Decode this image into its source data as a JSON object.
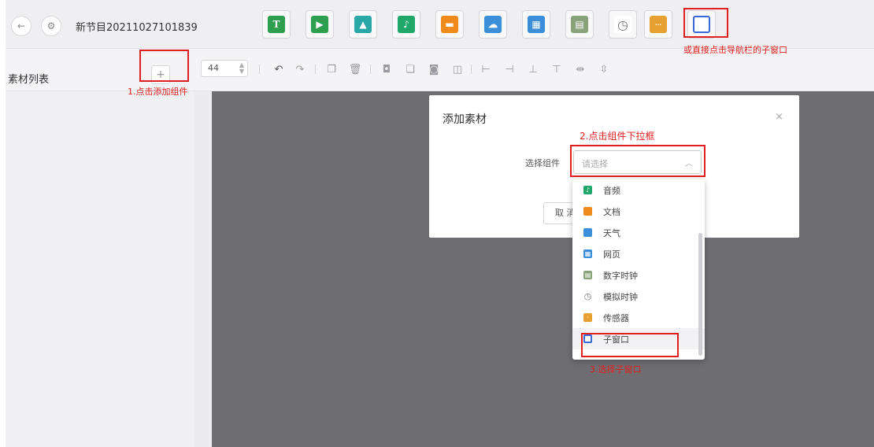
{
  "header": {
    "back_icon": "back-arrow-icon",
    "settings_icon": "settings-icon",
    "project_title": "新节目20211027101839",
    "component_icons": [
      {
        "name": "text-icon",
        "glyph": "T",
        "color": "#2e9e4f"
      },
      {
        "name": "video-icon",
        "glyph": "▶",
        "color": "#2e9e4f"
      },
      {
        "name": "image-icon",
        "glyph": "▲",
        "color": "#2aa8a8"
      },
      {
        "name": "audio-icon",
        "glyph": "♪",
        "color": "#1fa86a"
      },
      {
        "name": "document-icon",
        "glyph": "▬",
        "color": "#f08a1c"
      },
      {
        "name": "weather-icon",
        "glyph": "☁",
        "color": "#3a8fd8"
      },
      {
        "name": "webpage-icon",
        "glyph": "▦",
        "color": "#3a8fd8"
      },
      {
        "name": "digital-clock-icon",
        "glyph": "▤",
        "color": "#8aa27a"
      },
      {
        "name": "analog-clock-icon",
        "glyph": "◷",
        "color": "#777777"
      },
      {
        "name": "sensor-icon",
        "glyph": "···",
        "color": "#e8a030"
      },
      {
        "name": "sub-window-icon",
        "glyph": "▢",
        "color": "#3a6ad8"
      }
    ]
  },
  "toolbar": {
    "material_list_label": "素材列表",
    "add_button_label": "+",
    "font_size_value": "44",
    "font_size_stepper": "⌃⌄"
  },
  "annotations": {
    "step1": "1.点击添加组件",
    "step2": "2.点击组件下拉框",
    "step3": "3.选择子窗口",
    "alt": "或直接点击导航栏的子窗口"
  },
  "modal": {
    "title": "添加素材",
    "close": "×",
    "field_label": "选择组件",
    "select_placeholder": "请选择",
    "select_caret": "︿",
    "cancel_label": "取 消"
  },
  "dropdown": {
    "items": [
      {
        "label": "音频",
        "icon": "audio-icon",
        "color": "#1fa86a"
      },
      {
        "label": "文档",
        "icon": "document-icon",
        "color": "#f08a1c"
      },
      {
        "label": "天气",
        "icon": "weather-icon",
        "color": "#3a8fd8"
      },
      {
        "label": "网页",
        "icon": "webpage-icon",
        "color": "#3a8fd8"
      },
      {
        "label": "数字时钟",
        "icon": "digital-clock-icon",
        "color": "#8aa27a"
      },
      {
        "label": "模拟时钟",
        "icon": "analog-clock-icon",
        "color": "#777777"
      },
      {
        "label": "传感器",
        "icon": "sensor-icon",
        "color": "#e8a030"
      },
      {
        "label": "子窗口",
        "icon": "sub-window-icon",
        "color": "#3a6ad8"
      }
    ]
  },
  "colors": {
    "annotation_red": "#e02020",
    "canvas": "#6e6e72"
  }
}
